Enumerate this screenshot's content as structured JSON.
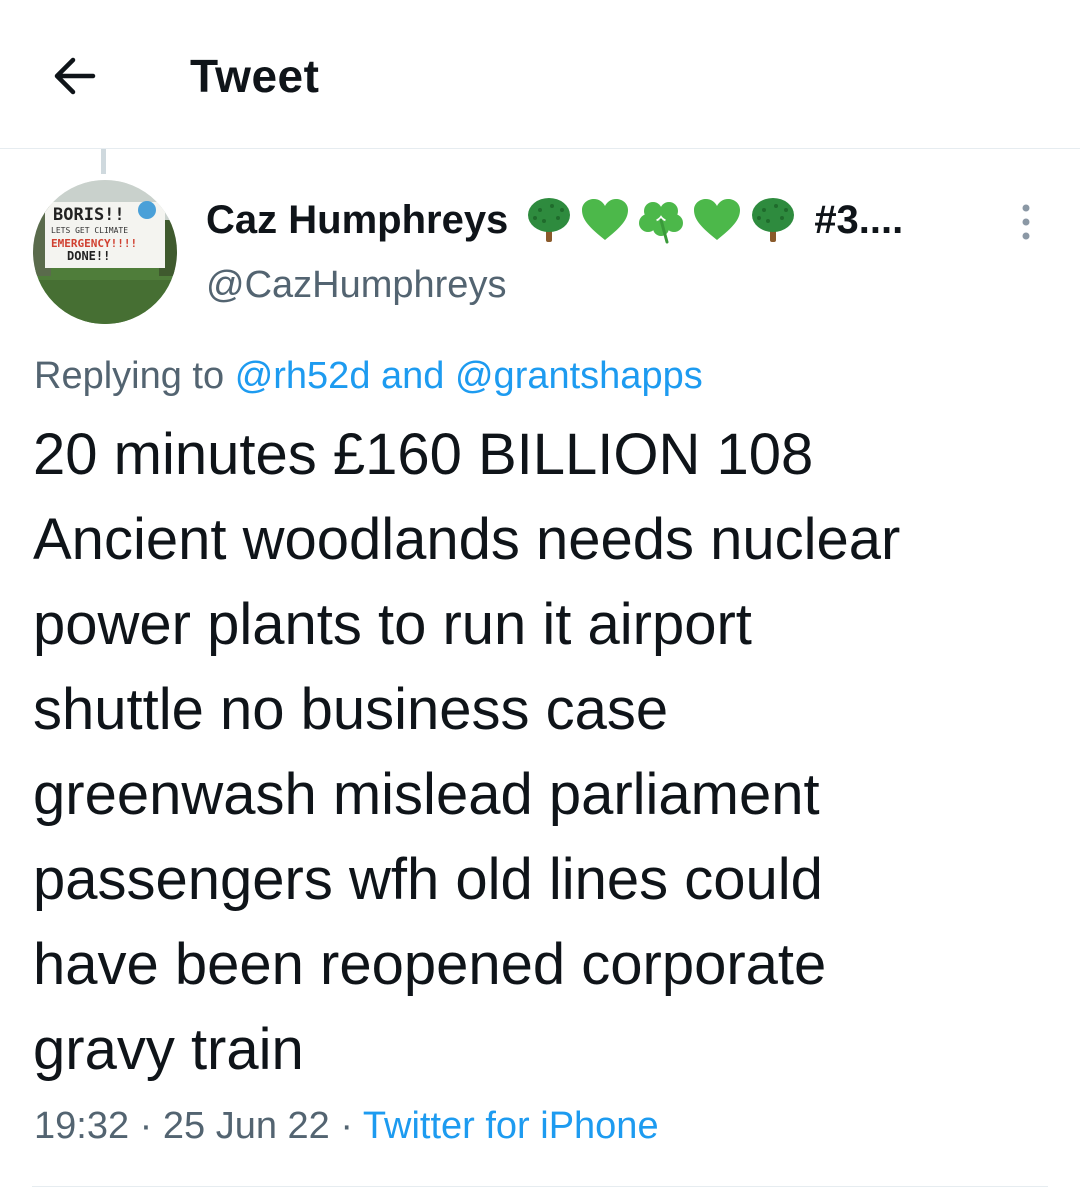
{
  "header": {
    "title": "Tweet",
    "back_icon": "arrow-left-icon"
  },
  "tweet": {
    "author": {
      "name": "Caz Humphreys",
      "name_emojis": [
        "deciduous-tree-icon",
        "green-heart-icon",
        "shamrock-icon",
        "green-heart-icon",
        "deciduous-tree-icon"
      ],
      "name_suffix": "#3....",
      "handle": "@CazHumphreys",
      "avatar_sign_text": [
        "BORIS!!",
        "LETS GET CLIMATE",
        "EMERGENCY!!!!",
        "DONE!!"
      ]
    },
    "replying": {
      "prefix": "Replying to",
      "mention_1": "@rh52d",
      "conjunction": "and",
      "mention_2": "@grantshapps"
    },
    "text_lines": [
      "20 minutes £160 BILLION 108",
      "Ancient woodlands needs nuclear",
      "power plants to run it airport",
      "shuttle no business case",
      "greenwash mislead parliament",
      "passengers wfh old lines could",
      "have been reopened corporate",
      "gravy train"
    ],
    "time": "19:32",
    "date": "25 Jun 22",
    "separator": "·",
    "source": "Twitter for iPhone"
  },
  "colors": {
    "text": "#0f1419",
    "secondary": "#536471",
    "link": "#1d9bf0",
    "divider": "#e6ecf0",
    "emoji_green": "#2e9e3e"
  }
}
